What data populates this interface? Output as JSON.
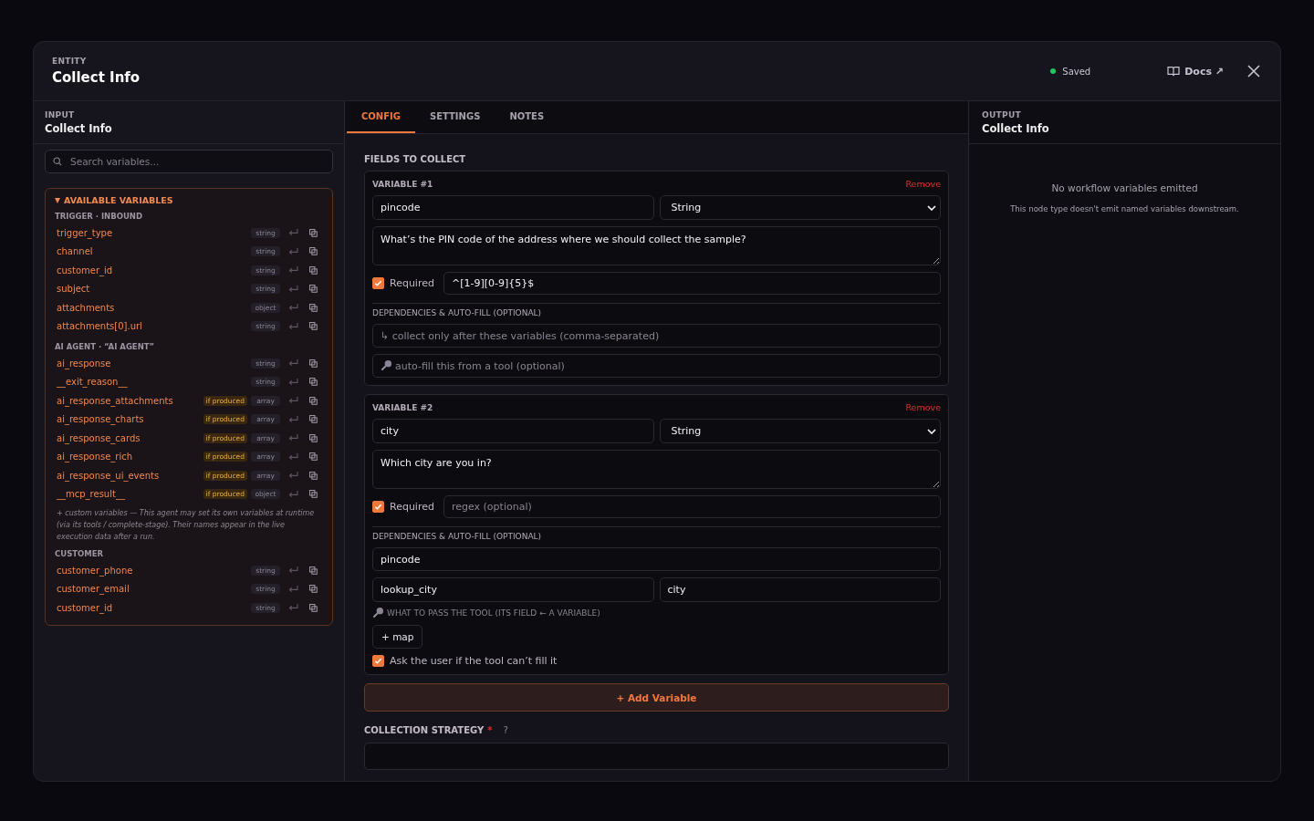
{
  "header": {
    "eyebrow": "ENTITY",
    "title": "Collect Info",
    "status": "Saved",
    "docs": "Docs ↗"
  },
  "input": {
    "eyebrow": "INPUT",
    "title": "Collect Info",
    "search": {
      "placeholder": "Search variables..."
    },
    "variables": {
      "title": "AVAILABLE VARIABLES",
      "expanded": true,
      "groups": [
        {
          "title": "TRIGGER · INBOUND",
          "items": [
            {
              "name": "trigger_type",
              "type": "string"
            },
            {
              "name": "channel",
              "type": "string"
            },
            {
              "name": "customer_id",
              "type": "string"
            },
            {
              "name": "subject",
              "type": "string"
            },
            {
              "name": "attachments",
              "type": "object"
            },
            {
              "name": "attachments[0].url",
              "type": "string"
            }
          ]
        },
        {
          "title": "AI AGENT · “AI AGENT”",
          "items": [
            {
              "name": "ai_response",
              "type": "string"
            },
            {
              "name": "__exit_reason__",
              "type": "string"
            },
            {
              "name": "ai_response_attachments",
              "badge": "if produced",
              "type": "array"
            },
            {
              "name": "ai_response_charts",
              "badge": "if produced",
              "type": "array"
            },
            {
              "name": "ai_response_cards",
              "badge": "if produced",
              "type": "array"
            },
            {
              "name": "ai_response_rich",
              "badge": "if produced",
              "type": "array"
            },
            {
              "name": "ai_response_ui_events",
              "badge": "if produced",
              "type": "array"
            },
            {
              "name": "__mcp_result__",
              "badge": "if produced",
              "type": "object"
            }
          ],
          "note": "+ custom variables — This agent may set its own variables at runtime (via its tools / complete-stage). Their names appear in the live execution data after a run."
        },
        {
          "title": "CUSTOMER",
          "items": [
            {
              "name": "customer_phone",
              "type": "string"
            },
            {
              "name": "customer_email",
              "type": "string"
            },
            {
              "name": "customer_id",
              "type": "string"
            }
          ]
        }
      ]
    }
  },
  "tabs": [
    {
      "label": "CONFIG",
      "selected": true
    },
    {
      "label": "SETTINGS",
      "selected": false
    },
    {
      "label": "NOTES",
      "selected": false
    }
  ],
  "config": {
    "section": "FIELDS TO COLLECT",
    "variables": [
      {
        "kind": "empty",
        "title": "VARIABLE #1",
        "remove": "Remove",
        "name": "pincode",
        "type": "String",
        "question": "What’s the PIN code of the address where we should collect the sample?",
        "required": true,
        "required_label": "Required",
        "regex": {
          "value": "^[1-9][0-9]{5}$"
        },
        "deps_label": "DEPENDENCIES & AUTO-FILL (OPTIONAL)",
        "after": {
          "placeholder": "↳ collect only after these variables (comma-separated)"
        },
        "tool": {
          "placeholder": "auto-fill this from a tool (optional)"
        }
      },
      {
        "kind": "filled",
        "title": "VARIABLE #2",
        "remove": "Remove",
        "name": "city",
        "type": "String",
        "question": "Which city are you in?",
        "required": true,
        "required_label": "Required",
        "regex": {
          "placeholder": "regex (optional)"
        },
        "deps_label": "DEPENDENCIES & AUTO-FILL (OPTIONAL)",
        "after": {
          "value": "pincode"
        },
        "tool": {
          "value": "lookup_city"
        },
        "tool_output": {
          "value": "city"
        },
        "map_hint": "WHAT TO PASS THE TOOL (ITS FIELD ← A VARIABLE)",
        "map_button": "+ map",
        "ask_user": true,
        "ask_label": "Ask the user if the tool can’t fill it"
      }
    ],
    "add": "+ Add Variable",
    "strategy": "COLLECTION STRATEGY",
    "strategy_required": "*",
    "strategy_help": "?"
  },
  "output": {
    "eyebrow": "OUTPUT",
    "title": "Collect Info",
    "empty_title": "No workflow variables emitted",
    "empty_text": "This node type doesn't emit named variables downstream."
  }
}
